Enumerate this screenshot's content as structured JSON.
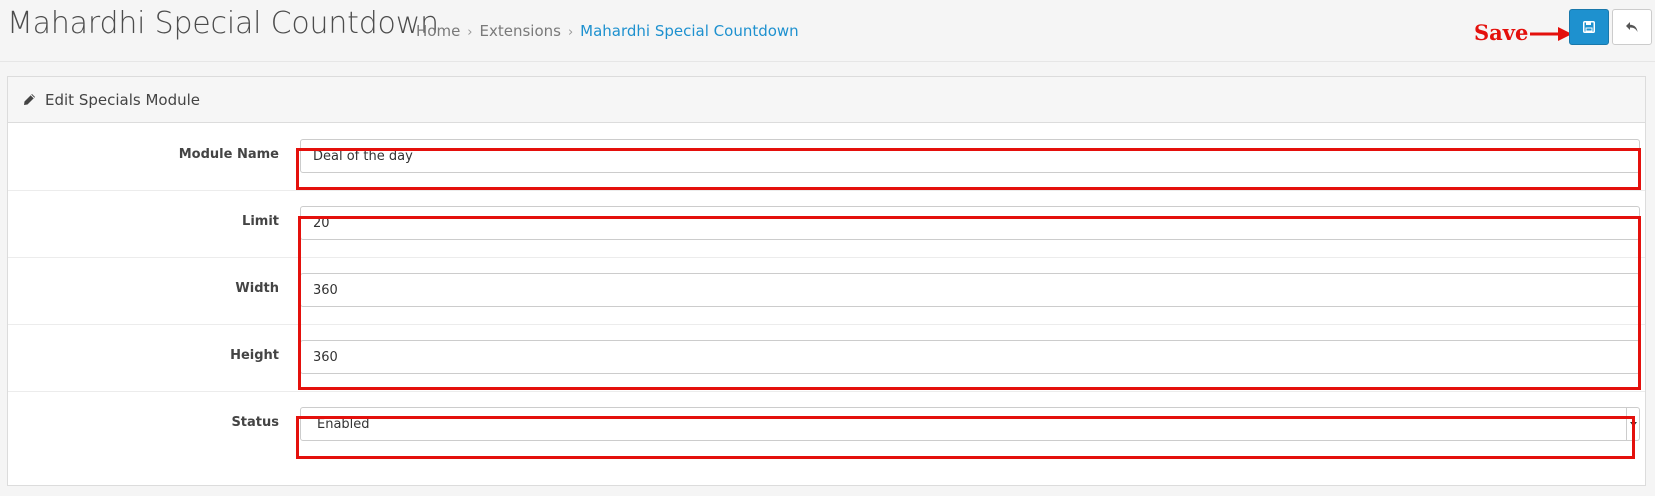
{
  "header": {
    "title": "Mahardhi Special Countdown",
    "breadcrumb": [
      "Home",
      "Extensions",
      "Mahardhi Special Countdown"
    ],
    "breadcrumb_separator": "›"
  },
  "annotation": {
    "save_label": "Save",
    "color": "#e4100c"
  },
  "toolbar": {
    "save_icon": "floppy-disk-icon",
    "back_icon": "reply-arrow-icon",
    "save_color": "#1e91cf"
  },
  "panel": {
    "heading": "Edit Specials Module",
    "heading_icon": "pencil-icon"
  },
  "form": {
    "module_name": {
      "label": "Module Name",
      "value": "Deal of the day"
    },
    "limit": {
      "label": "Limit",
      "value": "20"
    },
    "width": {
      "label": "Width",
      "value": "360"
    },
    "height": {
      "label": "Height",
      "value": "360"
    },
    "status": {
      "label": "Status",
      "value": "Enabled"
    }
  }
}
